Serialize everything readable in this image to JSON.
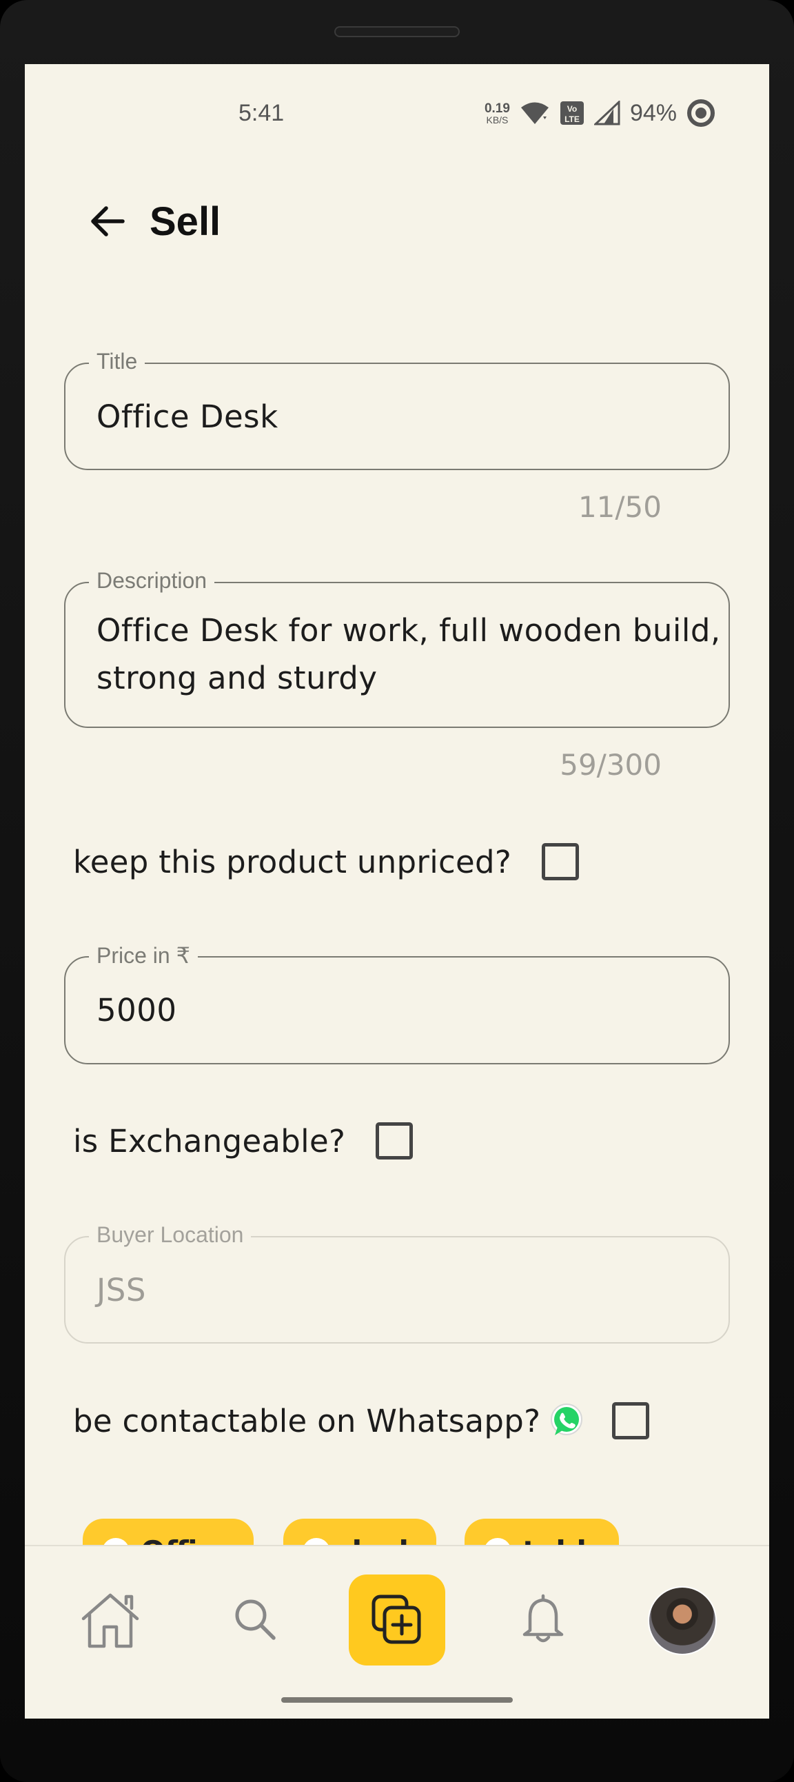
{
  "status_bar": {
    "time": "5:41",
    "net_speed_value": "0.19",
    "net_speed_unit": "KB/S",
    "battery_percent": "94%"
  },
  "header": {
    "title": "Sell",
    "back_icon": "arrow-left-icon"
  },
  "form": {
    "title": {
      "label": "Title",
      "value": "Office Desk",
      "counter": "11/50"
    },
    "description": {
      "label": "Description",
      "value_line1": "Office Desk for work, full wooden build,",
      "value_line2": "strong and sturdy",
      "counter": "59/300"
    },
    "unpriced": {
      "label": "keep this product unpriced?",
      "checked": false
    },
    "price": {
      "label": "Price in ₹",
      "value": "5000"
    },
    "exchangeable": {
      "label": "is Exchangeable?",
      "checked": false
    },
    "buyer_location": {
      "label": "Buyer Location",
      "value": "JSS",
      "disabled": true
    },
    "whatsapp": {
      "label": "be contactable on Whatsapp?",
      "icon": "whatsapp-icon",
      "checked": false
    }
  },
  "tags": [
    {
      "label": "Office"
    },
    {
      "label": "desk"
    },
    {
      "label": "table"
    }
  ],
  "nav": {
    "items": [
      "home-icon",
      "search-icon",
      "add-post-icon",
      "bell-icon",
      "profile-avatar"
    ]
  },
  "colors": {
    "background": "#f6f3e8",
    "accent": "#ffc91f",
    "outline": "#7a7a72",
    "whatsapp": "#25d366"
  }
}
